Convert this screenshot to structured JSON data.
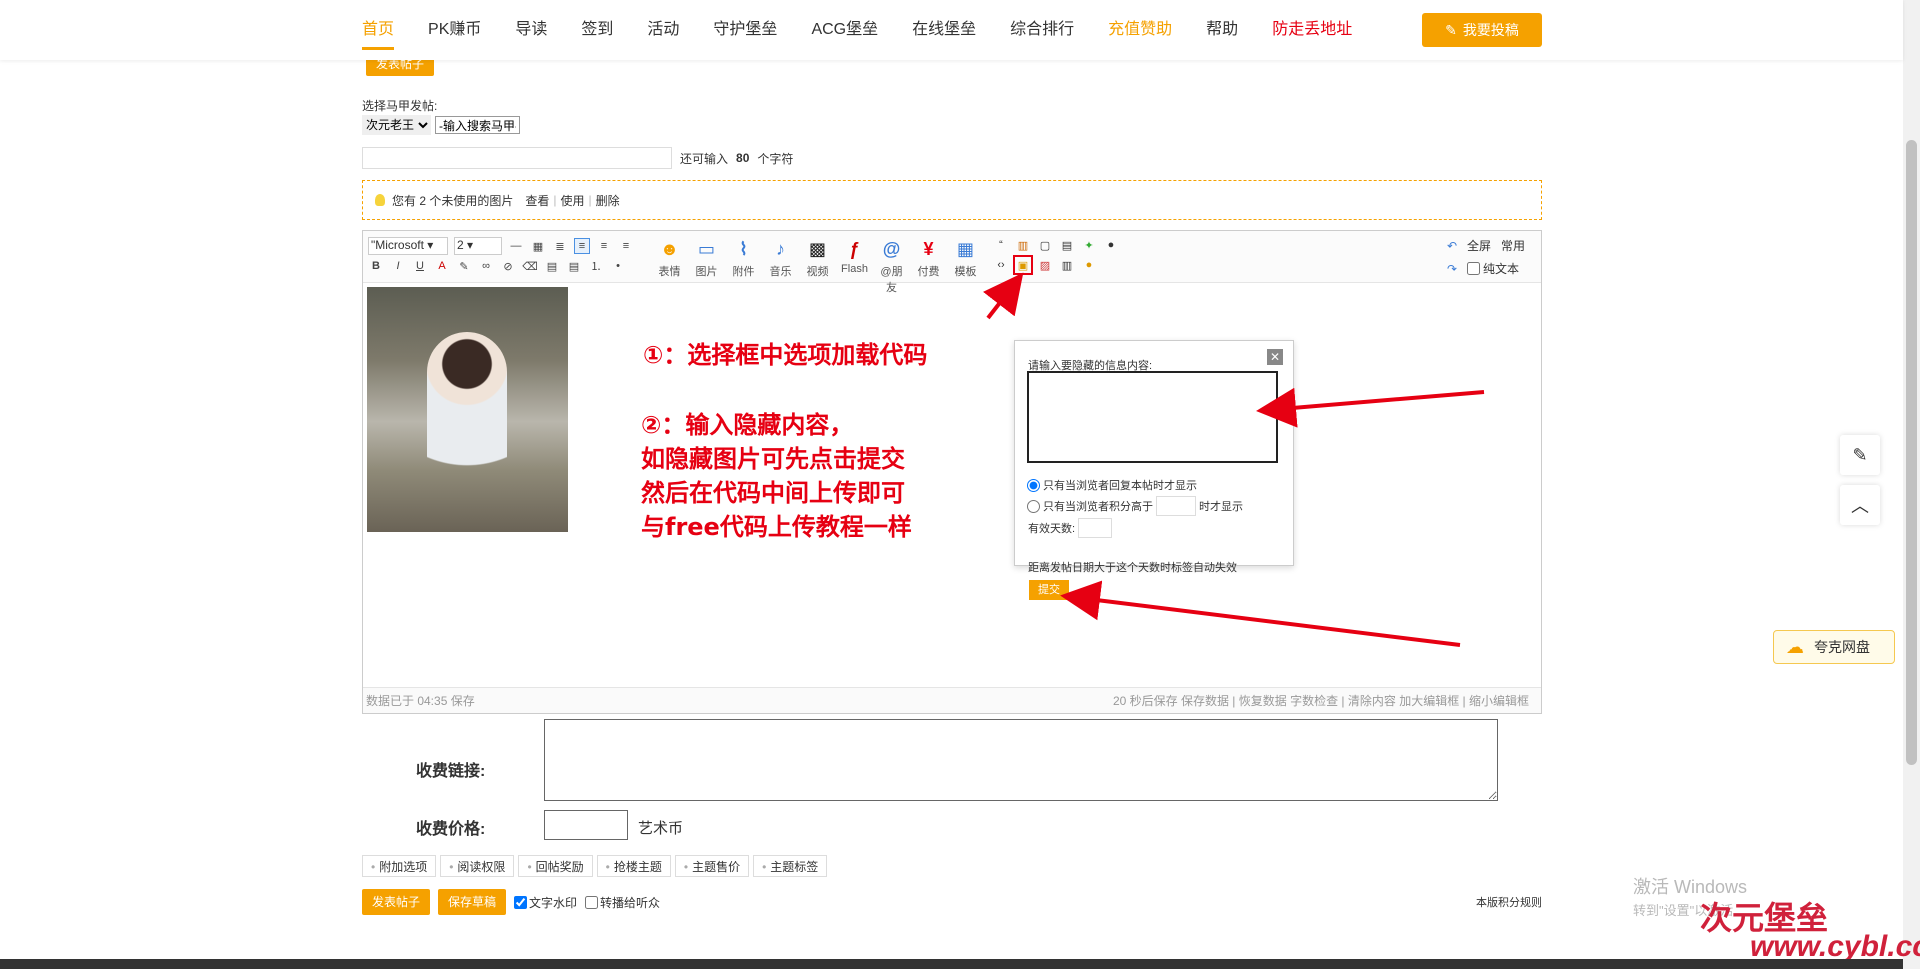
{
  "nav": {
    "items": [
      "首页",
      "PK赚币",
      "导读",
      "签到",
      "活动",
      "守护堡垒",
      "ACG堡垒",
      "在线堡垒",
      "综合排行",
      "充值赞助",
      "帮助",
      "防走丢地址"
    ],
    "post_button": "我要投稿"
  },
  "form": {
    "top_button": "发表帖子",
    "majia_label": "选择马甲发帖:",
    "majia_value": "次元老王",
    "majia_search_placeholder": "-输入搜索马甲-",
    "title_hint": "还可输入",
    "title_count": "80",
    "title_unit": "个字符"
  },
  "notice": {
    "text": "您有 2 个未使用的图片",
    "view": "查看",
    "use": "使用",
    "delete": "删除"
  },
  "editor": {
    "font": "\"Microsoft",
    "size": "2",
    "tools": [
      "表情",
      "图片",
      "附件",
      "音乐",
      "视频",
      "Flash",
      "@朋友",
      "付费",
      "模板"
    ],
    "right": {
      "fullscreen": "全屏",
      "common": "常用",
      "plain_text": "纯文本"
    },
    "status_left": "数据已于 04:35 保存",
    "status_right": "20 秒后保存 保存数据 | 恢复数据    字数检查 | 清除内容    加大编辑框 | 缩小编辑框"
  },
  "annotations": {
    "a1": "①：选择框中选项加载代码",
    "a2_1": "②：输入隐藏内容，",
    "a2_2": "如隐藏图片可先点击提交",
    "a2_3": "然后在代码中间上传即可",
    "a2_4": "与free代码上传教程一样"
  },
  "popup": {
    "label": "请输入要隐藏的信息内容:",
    "radio1": "只有当浏览者回复本帖时才显示",
    "radio2_pre": "只有当浏览者积分高于",
    "radio2_post": "时才显示",
    "days_label": "有效天数:",
    "days_desc": "距离发帖日期大于这个天数时标签自动失效",
    "submit": "提交"
  },
  "fee": {
    "link_label": "收费链接:",
    "price_label": "收费价格:",
    "unit": "艺术币"
  },
  "options": [
    "附加选项",
    "阅读权限",
    "回帖奖励",
    "抢楼主题",
    "主题售价",
    "主题标签"
  ],
  "bottom": {
    "submit": "发表帖子",
    "draft": "保存草稿",
    "watermark": "文字水印",
    "broadcast": "转播给听众",
    "rules": "本版积分规则"
  },
  "side": {
    "quark": "夸克网盘"
  },
  "watermarks": {
    "windows1": "激活 Windows",
    "windows2": "转到\"设置\"以激活",
    "site": "次元堡垒",
    "url": "www.cybl.cc"
  },
  "colors": {
    "accent": "#f5a100",
    "red": "#e60012"
  }
}
